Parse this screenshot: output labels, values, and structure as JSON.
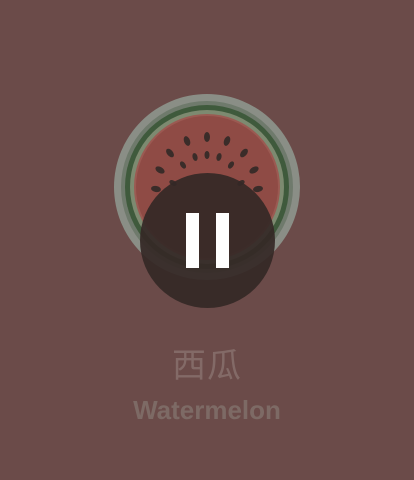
{
  "item": {
    "name_cn": "西瓜",
    "name_en": "Watermelon",
    "icon": "watermelon-icon"
  },
  "player": {
    "state": "playing",
    "control_icon": "pause-icon"
  },
  "colors": {
    "overlay_background": "#6b4b49",
    "rind_outer": "#8f9a91",
    "rind_dark": "#3f5a3c",
    "flesh": "#8f4b45",
    "seed": "#3a2c29",
    "pause_background": "#342826",
    "pause_bars": "#ffffff",
    "label_text": "#836a67"
  }
}
